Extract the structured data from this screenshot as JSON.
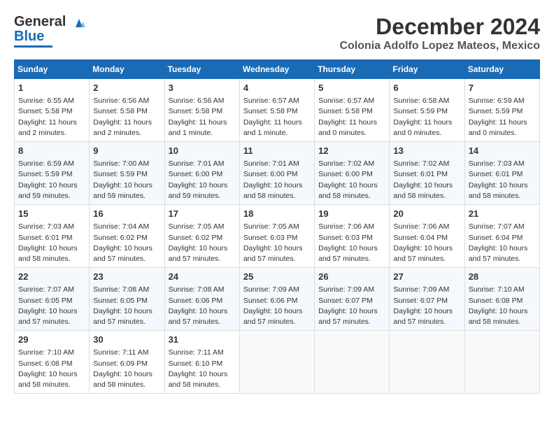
{
  "header": {
    "logo_line1": "General",
    "logo_line2": "Blue",
    "month": "December 2024",
    "location": "Colonia Adolfo Lopez Mateos, Mexico"
  },
  "days_of_week": [
    "Sunday",
    "Monday",
    "Tuesday",
    "Wednesday",
    "Thursday",
    "Friday",
    "Saturday"
  ],
  "weeks": [
    [
      {
        "day": "1",
        "sunrise": "6:55 AM",
        "sunset": "5:58 PM",
        "daylight": "11 hours and 2 minutes."
      },
      {
        "day": "2",
        "sunrise": "6:56 AM",
        "sunset": "5:58 PM",
        "daylight": "11 hours and 2 minutes."
      },
      {
        "day": "3",
        "sunrise": "6:56 AM",
        "sunset": "5:58 PM",
        "daylight": "11 hours and 1 minute."
      },
      {
        "day": "4",
        "sunrise": "6:57 AM",
        "sunset": "5:58 PM",
        "daylight": "11 hours and 1 minute."
      },
      {
        "day": "5",
        "sunrise": "6:57 AM",
        "sunset": "5:58 PM",
        "daylight": "11 hours and 0 minutes."
      },
      {
        "day": "6",
        "sunrise": "6:58 AM",
        "sunset": "5:59 PM",
        "daylight": "11 hours and 0 minutes."
      },
      {
        "day": "7",
        "sunrise": "6:59 AM",
        "sunset": "5:59 PM",
        "daylight": "11 hours and 0 minutes."
      }
    ],
    [
      {
        "day": "8",
        "sunrise": "6:59 AM",
        "sunset": "5:59 PM",
        "daylight": "10 hours and 59 minutes."
      },
      {
        "day": "9",
        "sunrise": "7:00 AM",
        "sunset": "5:59 PM",
        "daylight": "10 hours and 59 minutes."
      },
      {
        "day": "10",
        "sunrise": "7:01 AM",
        "sunset": "6:00 PM",
        "daylight": "10 hours and 59 minutes."
      },
      {
        "day": "11",
        "sunrise": "7:01 AM",
        "sunset": "6:00 PM",
        "daylight": "10 hours and 58 minutes."
      },
      {
        "day": "12",
        "sunrise": "7:02 AM",
        "sunset": "6:00 PM",
        "daylight": "10 hours and 58 minutes."
      },
      {
        "day": "13",
        "sunrise": "7:02 AM",
        "sunset": "6:01 PM",
        "daylight": "10 hours and 58 minutes."
      },
      {
        "day": "14",
        "sunrise": "7:03 AM",
        "sunset": "6:01 PM",
        "daylight": "10 hours and 58 minutes."
      }
    ],
    [
      {
        "day": "15",
        "sunrise": "7:03 AM",
        "sunset": "6:01 PM",
        "daylight": "10 hours and 58 minutes."
      },
      {
        "day": "16",
        "sunrise": "7:04 AM",
        "sunset": "6:02 PM",
        "daylight": "10 hours and 57 minutes."
      },
      {
        "day": "17",
        "sunrise": "7:05 AM",
        "sunset": "6:02 PM",
        "daylight": "10 hours and 57 minutes."
      },
      {
        "day": "18",
        "sunrise": "7:05 AM",
        "sunset": "6:03 PM",
        "daylight": "10 hours and 57 minutes."
      },
      {
        "day": "19",
        "sunrise": "7:06 AM",
        "sunset": "6:03 PM",
        "daylight": "10 hours and 57 minutes."
      },
      {
        "day": "20",
        "sunrise": "7:06 AM",
        "sunset": "6:04 PM",
        "daylight": "10 hours and 57 minutes."
      },
      {
        "day": "21",
        "sunrise": "7:07 AM",
        "sunset": "6:04 PM",
        "daylight": "10 hours and 57 minutes."
      }
    ],
    [
      {
        "day": "22",
        "sunrise": "7:07 AM",
        "sunset": "6:05 PM",
        "daylight": "10 hours and 57 minutes."
      },
      {
        "day": "23",
        "sunrise": "7:08 AM",
        "sunset": "6:05 PM",
        "daylight": "10 hours and 57 minutes."
      },
      {
        "day": "24",
        "sunrise": "7:08 AM",
        "sunset": "6:06 PM",
        "daylight": "10 hours and 57 minutes."
      },
      {
        "day": "25",
        "sunrise": "7:09 AM",
        "sunset": "6:06 PM",
        "daylight": "10 hours and 57 minutes."
      },
      {
        "day": "26",
        "sunrise": "7:09 AM",
        "sunset": "6:07 PM",
        "daylight": "10 hours and 57 minutes."
      },
      {
        "day": "27",
        "sunrise": "7:09 AM",
        "sunset": "6:07 PM",
        "daylight": "10 hours and 57 minutes."
      },
      {
        "day": "28",
        "sunrise": "7:10 AM",
        "sunset": "6:08 PM",
        "daylight": "10 hours and 58 minutes."
      }
    ],
    [
      {
        "day": "29",
        "sunrise": "7:10 AM",
        "sunset": "6:08 PM",
        "daylight": "10 hours and 58 minutes."
      },
      {
        "day": "30",
        "sunrise": "7:11 AM",
        "sunset": "6:09 PM",
        "daylight": "10 hours and 58 minutes."
      },
      {
        "day": "31",
        "sunrise": "7:11 AM",
        "sunset": "6:10 PM",
        "daylight": "10 hours and 58 minutes."
      },
      null,
      null,
      null,
      null
    ]
  ],
  "labels": {
    "sunrise": "Sunrise:",
    "sunset": "Sunset:",
    "daylight": "Daylight:"
  }
}
